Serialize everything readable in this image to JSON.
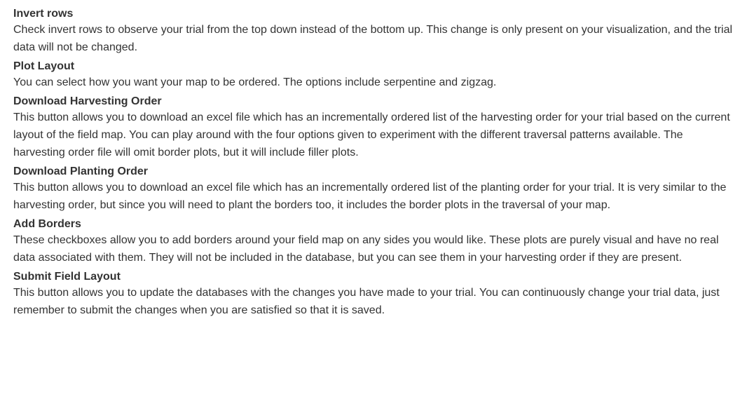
{
  "sections": [
    {
      "title": "Invert rows",
      "description": "Check invert rows to observe your trial from the top down instead of the bottom up. This change is only present on your visualization, and the trial data will not be changed."
    },
    {
      "title": "Plot Layout",
      "description": "You can select how you want your map to be ordered. The options include serpentine and zigzag."
    },
    {
      "title": "Download Harvesting Order",
      "description": "This button allows you to download an excel file which has an incrementally ordered list of the harvesting order for your trial based on the current layout of the field map. You can play around with the four options given to experiment with the different traversal patterns available. The harvesting order file will omit border plots, but it will include filler plots."
    },
    {
      "title": "Download Planting Order",
      "description": "This button allows you to download an excel file which has an incrementally ordered list of the planting order for your trial. It is very similar to the harvesting order, but since you will need to plant the borders too, it includes the border plots in the traversal of your map."
    },
    {
      "title": "Add Borders",
      "description": "These checkboxes allow you to add borders around your field map on any sides you would like. These plots are purely visual and have no real data associated with them. They will not be included in the database, but you can see them in your harvesting order if they are present."
    },
    {
      "title": "Submit Field Layout",
      "description": "This button allows you to update the databases with the changes you have made to your trial. You can continuously change your trial data, just remember to submit the changes when you are satisfied so that it is saved."
    }
  ]
}
